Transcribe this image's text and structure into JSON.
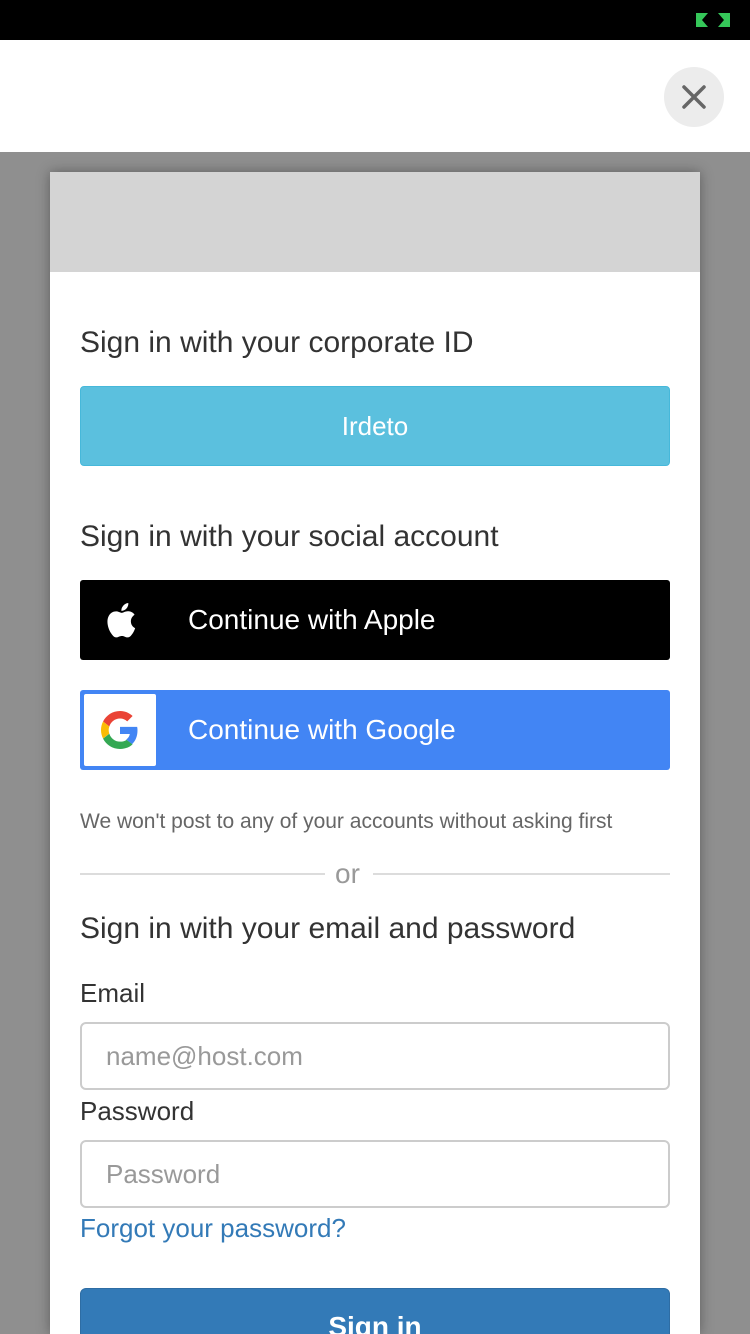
{
  "icons": {
    "status": "status-indicator-icon",
    "close": "close-icon",
    "apple": "apple-logo-icon",
    "google": "google-logo-icon"
  },
  "colors": {
    "irdeto": "#5bc0de",
    "apple": "#000000",
    "google": "#4285f4",
    "primary": "#337ab7",
    "link": "#337ab7"
  },
  "corporate": {
    "heading": "Sign in with your corporate ID",
    "button_label": "Irdeto"
  },
  "social": {
    "heading": "Sign in with your social account",
    "apple_label": "Continue with Apple",
    "google_label": "Continue with Google",
    "note": "We won't post to any of your accounts without asking first"
  },
  "divider": {
    "text": "or"
  },
  "email_login": {
    "heading": "Sign in with your email and password",
    "email_label": "Email",
    "email_placeholder": "name@host.com",
    "email_value": "",
    "password_label": "Password",
    "password_placeholder": "Password",
    "password_value": "",
    "forgot_link": "Forgot your password?",
    "submit_label": "Sign in"
  }
}
